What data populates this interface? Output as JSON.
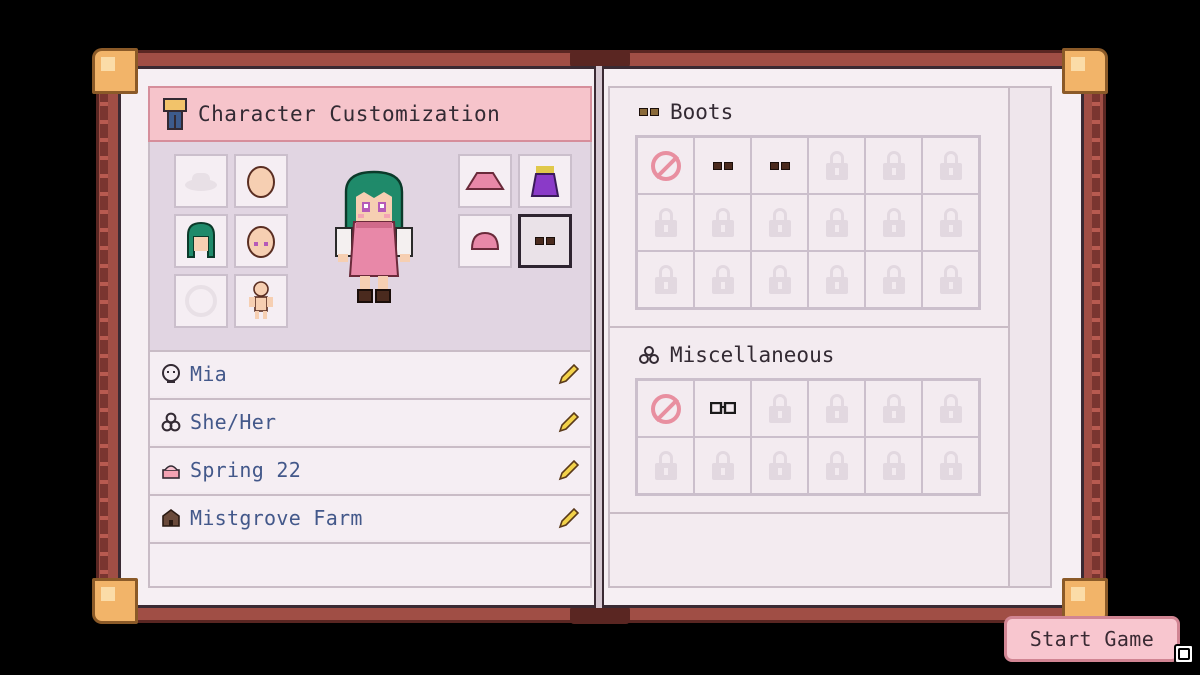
{
  "panel_title": "Character Customization",
  "info_rows": [
    {
      "label": "Mia",
      "icon": "face-icon"
    },
    {
      "label": "She/Her",
      "icon": "pronouns-icon"
    },
    {
      "label": "Spring 22",
      "icon": "cake-icon"
    },
    {
      "label": "Mistgrove Farm",
      "icon": "barn-icon"
    }
  ],
  "sections": {
    "boots": {
      "title": "Boots",
      "rows": 3,
      "cols": 6,
      "unlocked": [
        "none",
        "boots-brown",
        "boots-brown-small"
      ]
    },
    "misc": {
      "title": "Miscellaneous",
      "rows": 2,
      "cols": 6,
      "unlocked": [
        "none",
        "glasses"
      ]
    }
  },
  "start_label": "Start Game",
  "colors": {
    "accent": "#f6c4cb",
    "text_link": "#43588a",
    "hair": "#1f8a6a",
    "dress": "#e888a8"
  }
}
